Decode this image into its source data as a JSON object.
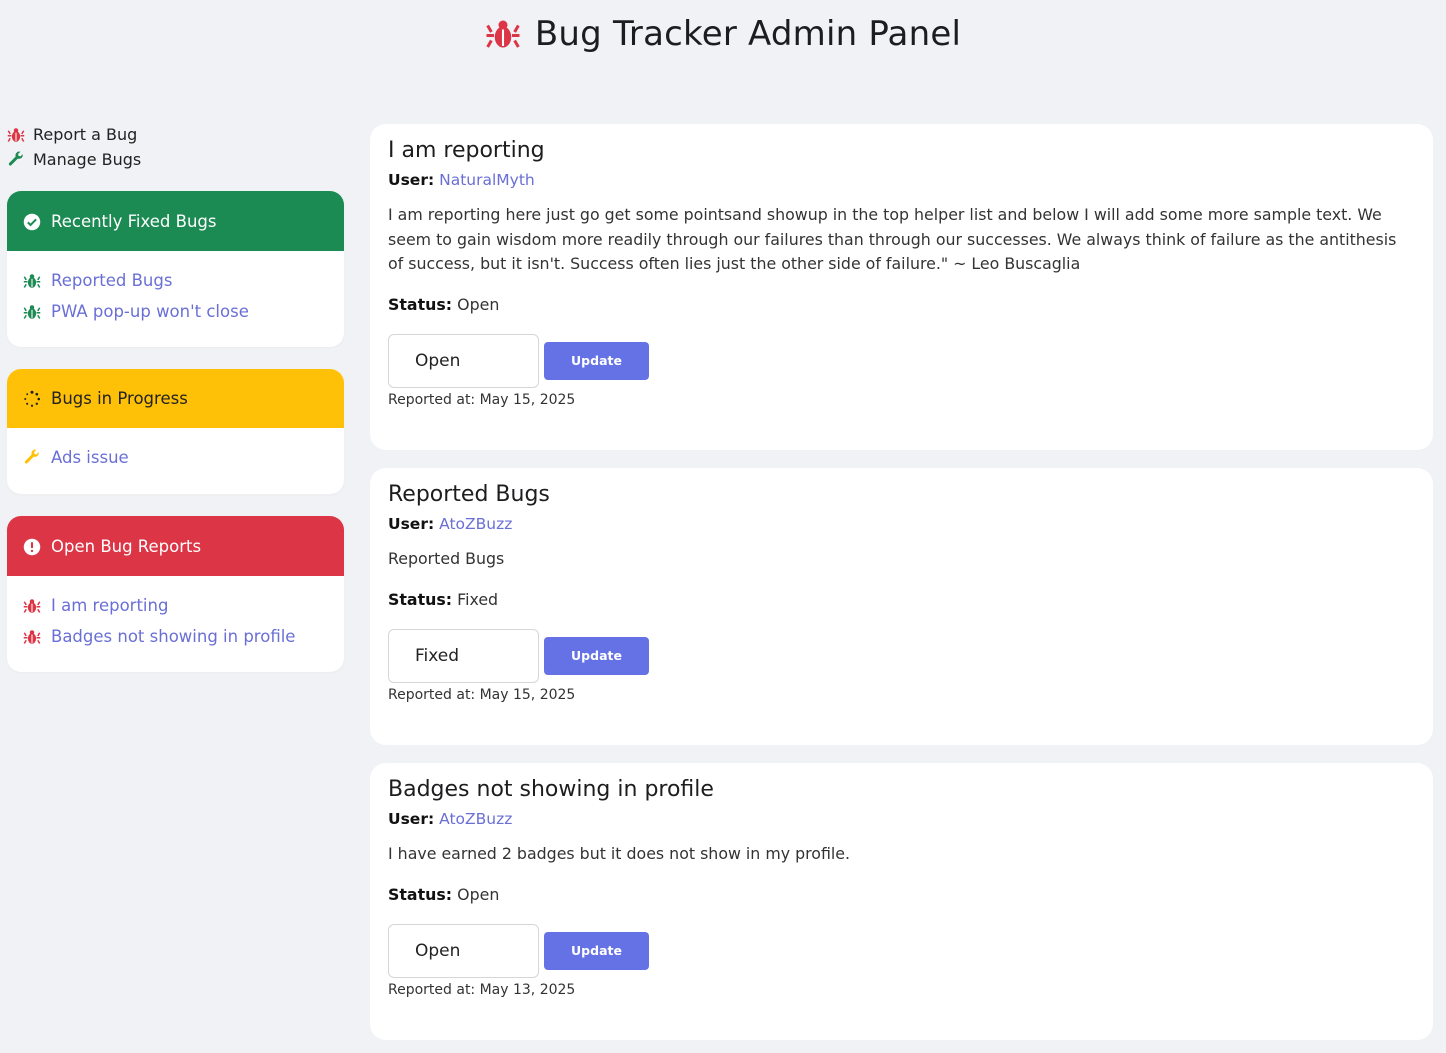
{
  "header": {
    "title": "Bug Tracker Admin Panel",
    "icon": "bug-icon"
  },
  "colors": {
    "red": "#dc3545",
    "green": "#1b8a53",
    "yellow": "#ffc107",
    "link": "#6a6fd6",
    "button": "#6472e6",
    "background": "#f0f2f5"
  },
  "nav": {
    "report_label": "Report a Bug",
    "manage_label": "Manage Bugs"
  },
  "sidebar": {
    "fixed": {
      "title": "Recently Fixed Bugs",
      "icon": "check-circle-icon",
      "items": [
        "Reported Bugs",
        "PWA pop-up won't close"
      ]
    },
    "progress": {
      "title": "Bugs in Progress",
      "icon": "spinner-icon",
      "items": [
        "Ads issue"
      ]
    },
    "open": {
      "title": "Open Bug Reports",
      "icon": "exclamation-circle-icon",
      "items": [
        "I am reporting",
        "Badges not showing in profile"
      ]
    }
  },
  "labels": {
    "user": "User:",
    "status": "Status:",
    "update": "Update"
  },
  "bugs": [
    {
      "title": "I am reporting",
      "user": "NaturalMyth",
      "description": "I am reporting here just go get some pointsand showup in the top helper list and below I will add some more sample text. We seem to gain wisdom more readily through our failures than through our successes. We always think of failure as the antithesis of success, but it isn't. Success often lies just the other side of failure.\" ~ Leo Buscaglia",
      "status": "Open",
      "select_value": "Open",
      "reported_at": "Reported at: May 15, 2025"
    },
    {
      "title": "Reported Bugs",
      "user": "AtoZBuzz",
      "description": "Reported Bugs",
      "status": "Fixed",
      "select_value": "Fixed",
      "reported_at": "Reported at: May 15, 2025"
    },
    {
      "title": "Badges not showing in profile",
      "user": "AtoZBuzz",
      "description": "I have earned 2 badges but it does not show in my profile.",
      "status": "Open",
      "select_value": "Open",
      "reported_at": "Reported at: May 13, 2025"
    }
  ]
}
